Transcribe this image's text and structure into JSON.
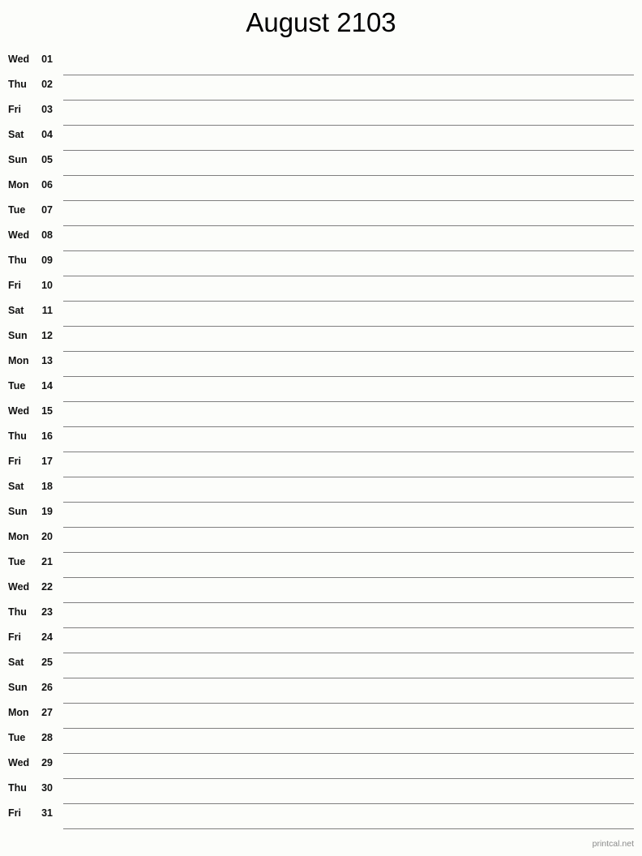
{
  "page": {
    "title": "August 2103",
    "month": "August",
    "year": "2103",
    "background_color": "#fcfdfa",
    "line_color": "#7f7f7f",
    "text_color": "#111111"
  },
  "footer": {
    "credit": "printcal.net",
    "color": "#8a8a8a"
  },
  "days": [
    {
      "dow": "Wed",
      "num": "01"
    },
    {
      "dow": "Thu",
      "num": "02"
    },
    {
      "dow": "Fri",
      "num": "03"
    },
    {
      "dow": "Sat",
      "num": "04"
    },
    {
      "dow": "Sun",
      "num": "05"
    },
    {
      "dow": "Mon",
      "num": "06"
    },
    {
      "dow": "Tue",
      "num": "07"
    },
    {
      "dow": "Wed",
      "num": "08"
    },
    {
      "dow": "Thu",
      "num": "09"
    },
    {
      "dow": "Fri",
      "num": "10"
    },
    {
      "dow": "Sat",
      "num": "11"
    },
    {
      "dow": "Sun",
      "num": "12"
    },
    {
      "dow": "Mon",
      "num": "13"
    },
    {
      "dow": "Tue",
      "num": "14"
    },
    {
      "dow": "Wed",
      "num": "15"
    },
    {
      "dow": "Thu",
      "num": "16"
    },
    {
      "dow": "Fri",
      "num": "17"
    },
    {
      "dow": "Sat",
      "num": "18"
    },
    {
      "dow": "Sun",
      "num": "19"
    },
    {
      "dow": "Mon",
      "num": "20"
    },
    {
      "dow": "Tue",
      "num": "21"
    },
    {
      "dow": "Wed",
      "num": "22"
    },
    {
      "dow": "Thu",
      "num": "23"
    },
    {
      "dow": "Fri",
      "num": "24"
    },
    {
      "dow": "Sat",
      "num": "25"
    },
    {
      "dow": "Sun",
      "num": "26"
    },
    {
      "dow": "Mon",
      "num": "27"
    },
    {
      "dow": "Tue",
      "num": "28"
    },
    {
      "dow": "Wed",
      "num": "29"
    },
    {
      "dow": "Thu",
      "num": "30"
    },
    {
      "dow": "Fri",
      "num": "31"
    }
  ]
}
